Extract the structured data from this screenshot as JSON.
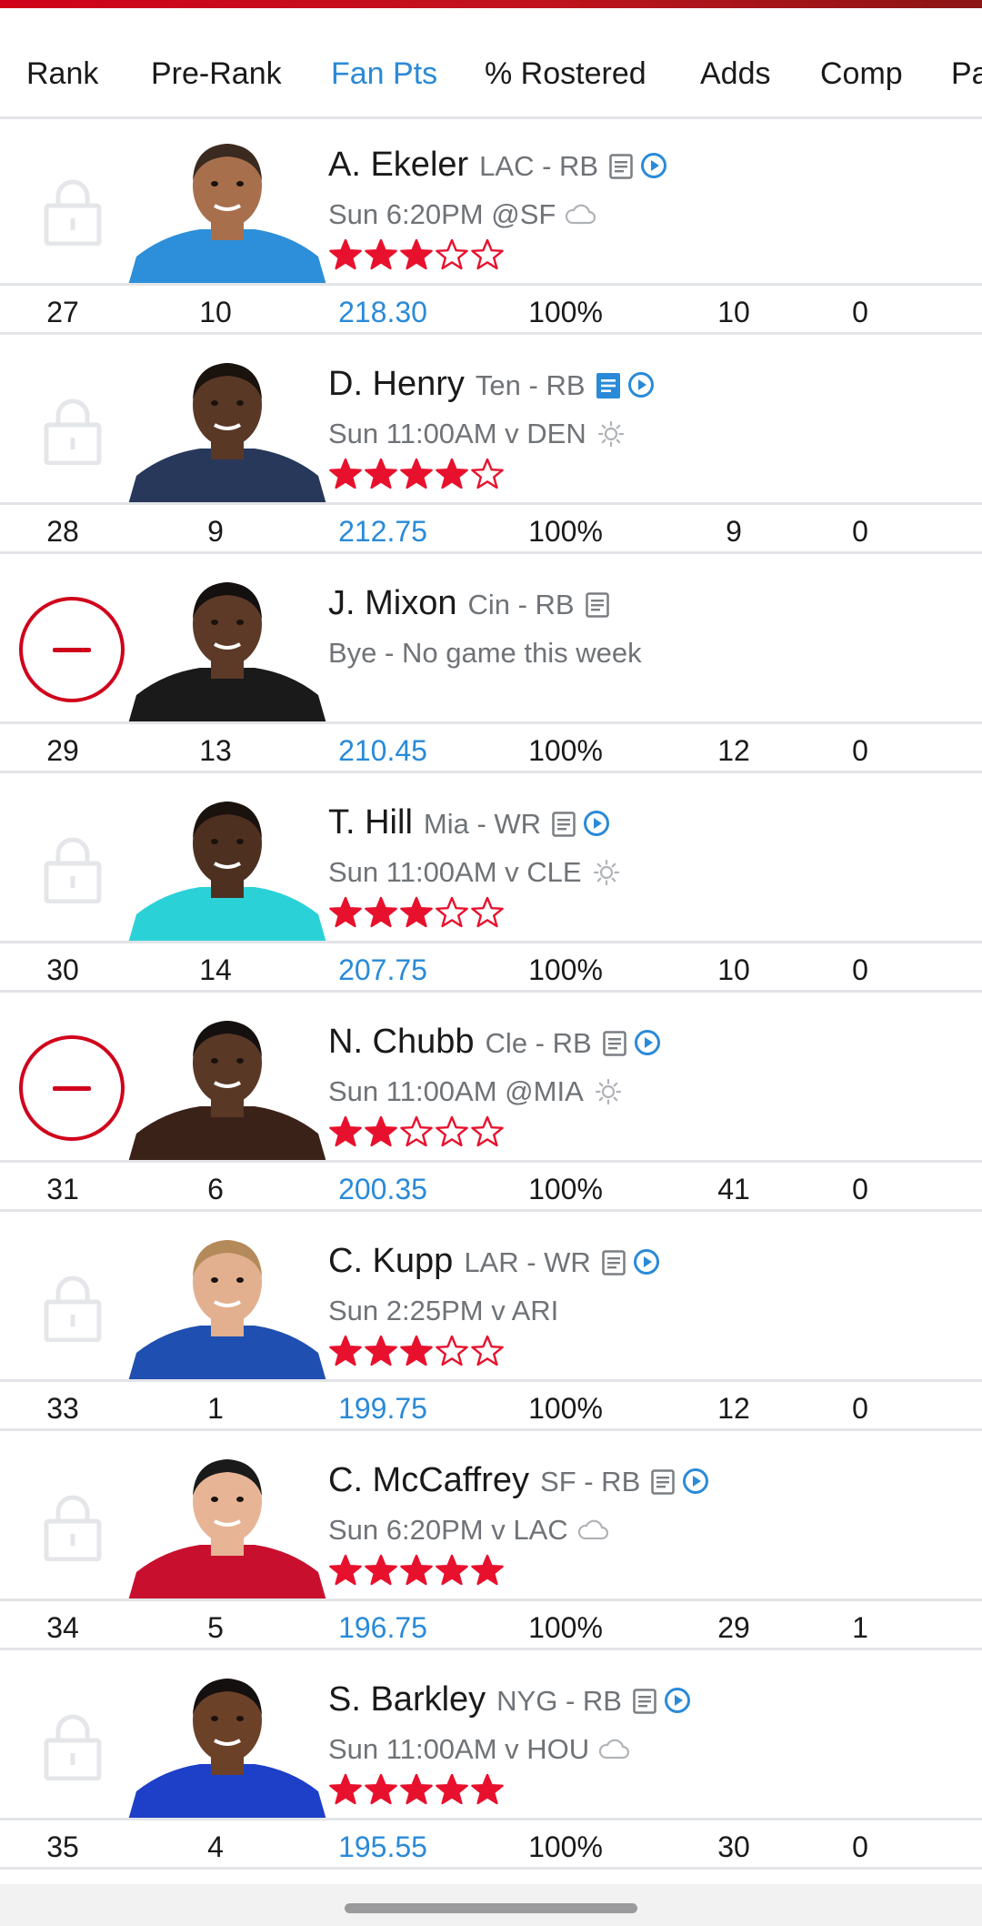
{
  "colors": {
    "brand_red": "#d0021b",
    "accent_blue": "#2a8ad8",
    "muted_text": "#6f7377",
    "divider": "#e2e4e7"
  },
  "columns": [
    {
      "label": "Rank",
      "active": false
    },
    {
      "label": "Pre-Rank",
      "active": false
    },
    {
      "label": "Fan Pts",
      "active": true
    },
    {
      "label": "% Rostered",
      "active": false
    },
    {
      "label": "Adds",
      "active": false
    },
    {
      "label": "Comp",
      "active": false
    },
    {
      "label": "Pa",
      "active": false
    }
  ],
  "players": [
    {
      "name": "A. Ekeler",
      "team_pos": "LAC - RB",
      "game": "Sun 6:20PM @SF",
      "weather": "cloud-icon",
      "stars": 3,
      "action": "locked",
      "news_highlight": false,
      "has_video": true,
      "jersey": "#2d8fd9",
      "skin": "#a86f4d",
      "hair": "#3a2a20",
      "stats": {
        "rank": "27",
        "pre_rank": "10",
        "fan_pts": "218.30",
        "rostered": "100%",
        "adds": "10",
        "comp": "0"
      }
    },
    {
      "name": "D. Henry",
      "team_pos": "Ten - RB",
      "game": "Sun 11:00AM v DEN",
      "weather": "sun-icon",
      "stars": 4,
      "action": "locked",
      "news_highlight": true,
      "has_video": true,
      "jersey": "#27385a",
      "skin": "#5a3826",
      "hair": "#1a120c",
      "stats": {
        "rank": "28",
        "pre_rank": "9",
        "fan_pts": "212.75",
        "rostered": "100%",
        "adds": "9",
        "comp": "0"
      }
    },
    {
      "name": "J. Mixon",
      "team_pos": "Cin - RB",
      "game": "Bye - No game this week",
      "weather": "",
      "stars": 0,
      "action": "drop",
      "news_highlight": false,
      "has_video": false,
      "jersey": "#1a1a1a",
      "skin": "#5c3a27",
      "hair": "#151010",
      "stats": {
        "rank": "29",
        "pre_rank": "13",
        "fan_pts": "210.45",
        "rostered": "100%",
        "adds": "12",
        "comp": "0"
      }
    },
    {
      "name": "T. Hill",
      "team_pos": "Mia - WR",
      "game": "Sun 11:00AM v CLE",
      "weather": "sun-icon",
      "stars": 3,
      "action": "locked",
      "news_highlight": false,
      "has_video": true,
      "jersey": "#2ad2d8",
      "skin": "#4e3021",
      "hair": "#1a120c",
      "stats": {
        "rank": "30",
        "pre_rank": "14",
        "fan_pts": "207.75",
        "rostered": "100%",
        "adds": "10",
        "comp": "0"
      }
    },
    {
      "name": "N. Chubb",
      "team_pos": "Cle - RB",
      "game": "Sun 11:00AM @MIA",
      "weather": "sun-icon",
      "stars": 2,
      "action": "drop",
      "news_highlight": false,
      "has_video": true,
      "jersey": "#3b2218",
      "skin": "#5a3826",
      "hair": "#151010",
      "stats": {
        "rank": "31",
        "pre_rank": "6",
        "fan_pts": "200.35",
        "rostered": "100%",
        "adds": "41",
        "comp": "0"
      }
    },
    {
      "name": "C. Kupp",
      "team_pos": "LAR - WR",
      "game": "Sun 2:25PM v ARI",
      "weather": "",
      "stars": 3,
      "action": "locked",
      "news_highlight": false,
      "has_video": true,
      "jersey": "#1f4fb0",
      "skin": "#e2b08f",
      "hair": "#b58a5a",
      "stats": {
        "rank": "33",
        "pre_rank": "1",
        "fan_pts": "199.75",
        "rostered": "100%",
        "adds": "12",
        "comp": "0"
      }
    },
    {
      "name": "C. McCaffrey",
      "team_pos": "SF - RB",
      "game": "Sun 6:20PM v LAC",
      "weather": "cloud-icon",
      "stars": 5,
      "action": "locked",
      "news_highlight": false,
      "has_video": true,
      "jersey": "#c8102e",
      "skin": "#e7b596",
      "hair": "#1a1a1a",
      "stats": {
        "rank": "34",
        "pre_rank": "5",
        "fan_pts": "196.75",
        "rostered": "100%",
        "adds": "29",
        "comp": "1"
      }
    },
    {
      "name": "S. Barkley",
      "team_pos": "NYG - RB",
      "game": "Sun 11:00AM v HOU",
      "weather": "cloud-icon",
      "stars": 5,
      "action": "locked",
      "news_highlight": false,
      "has_video": true,
      "jersey": "#1e40c8",
      "skin": "#6b4128",
      "hair": "#151010",
      "stats": {
        "rank": "35",
        "pre_rank": "4",
        "fan_pts": "195.55",
        "rostered": "100%",
        "adds": "30",
        "comp": "0"
      }
    }
  ]
}
